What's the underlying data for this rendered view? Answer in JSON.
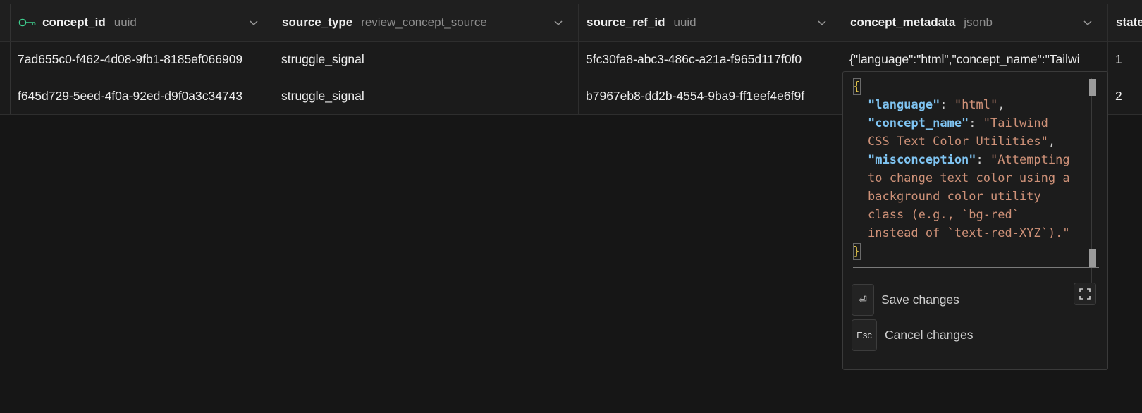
{
  "columns": [
    {
      "name": "concept_id",
      "type": "uuid",
      "is_primary_key": true
    },
    {
      "name": "source_type",
      "type": "review_concept_source"
    },
    {
      "name": "source_ref_id",
      "type": "uuid"
    },
    {
      "name": "concept_metadata",
      "type": "jsonb"
    },
    {
      "name": "state",
      "type": ""
    }
  ],
  "rows": [
    {
      "concept_id": "7ad655c0-f462-4d08-9fb1-8185ef066909",
      "source_type": "struggle_signal",
      "source_ref_id": "5fc30fa8-abc3-486c-a21a-f965d117f0f0",
      "concept_metadata": "{\"language\":\"html\",\"concept_name\":\"Tailwi",
      "state": "1"
    },
    {
      "concept_id": "f645d729-5eed-4f0a-92ed-d9f0a3c34743",
      "source_type": "struggle_signal",
      "source_ref_id": "b7967eb8-dd2b-4554-9ba9-ff1eef4e6f9f",
      "concept_metadata": "",
      "state": "2"
    }
  ],
  "editor": {
    "open_brace": "{",
    "close_brace": "}",
    "lines": [
      {
        "key": "\"language\"",
        "sep": ": ",
        "value": "\"html\"",
        "tail": ","
      },
      {
        "key": "\"concept_name\"",
        "sep": ": ",
        "value": "\"Tailwind",
        "tail": ""
      },
      {
        "key": "",
        "sep": "",
        "value": "CSS Text Color Utilities\"",
        "tail": ","
      },
      {
        "key": "\"misconception\"",
        "sep": ": ",
        "value": "\"Attempting",
        "tail": ""
      },
      {
        "key": "",
        "sep": "",
        "value": "to change text color using a",
        "tail": ""
      },
      {
        "key": "",
        "sep": "",
        "value": "background color utility",
        "tail": ""
      },
      {
        "key": "",
        "sep": "",
        "value": "class (e.g., `bg-red`",
        "tail": ""
      },
      {
        "key": "",
        "sep": "",
        "value": "instead of `text-red-XYZ`).\"",
        "tail": ""
      }
    ],
    "save_key": "⏎",
    "save_label": "Save changes",
    "cancel_key": "Esc",
    "cancel_label": "Cancel changes",
    "expand_icon": "expand-icon"
  },
  "colors": {
    "key_icon": "#3ecf8e",
    "json_key": "#7fc4f2",
    "json_string": "#ce9178",
    "brace": "#e6c84a"
  }
}
